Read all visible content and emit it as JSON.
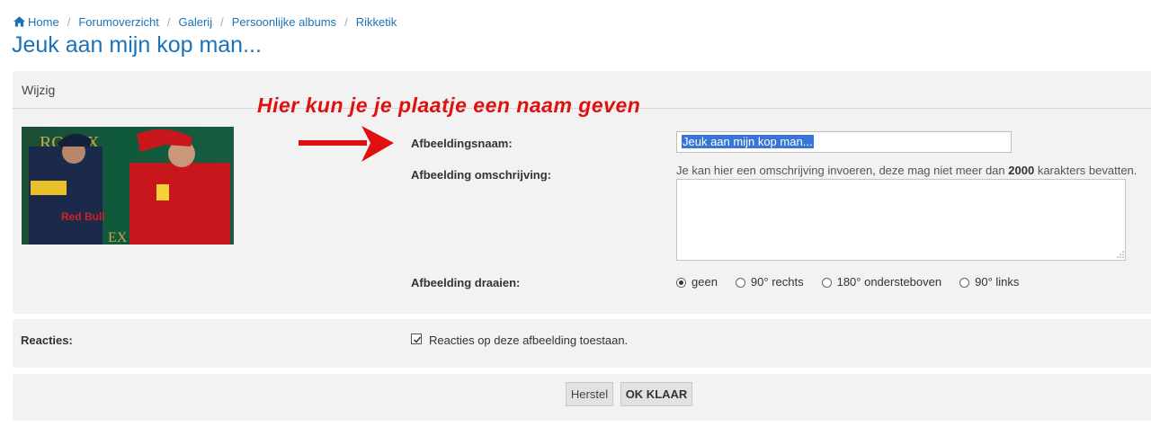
{
  "breadcrumb": {
    "items": [
      "Home",
      "Forumoverzicht",
      "Galerij",
      "Persoonlijke albums",
      "Rikketik"
    ]
  },
  "page_title": "Jeuk aan mijn kop man...",
  "edit_panel": {
    "header": "Wijzig",
    "annotation": "Hier kun je je plaatje een naam geven",
    "photo_text": {
      "logo_top": "ROLEX",
      "red_bull_text": "Red Bull",
      "logo_bottom": "EX"
    },
    "name_label": "Afbeeldingsnaam:",
    "name_value": "Jeuk aan mijn kop man...",
    "description_label": "Afbeelding omschrijving:",
    "description_hint_prefix": "Je kan hier een omschrijving invoeren, deze mag niet meer dan",
    "description_hint_number": "2000",
    "description_hint_suffix": "karakters bevatten.",
    "description_value": "",
    "rotate_label": "Afbeelding draaien:",
    "rotate_options": [
      "geen",
      "90° rechts",
      "180° ondersteboven",
      "90° links"
    ],
    "rotate_selected": "geen"
  },
  "reacties": {
    "label": "Reacties:",
    "checkbox_label": "Reacties op deze afbeelding toestaan.",
    "checked": true
  },
  "buttons": {
    "reset": "Herstel",
    "ok": "OK KLAAR"
  },
  "colors": {
    "link": "#1a73b8",
    "annotation": "#e01010",
    "panel": "#f2f2f2",
    "selection": "#3875d7"
  }
}
